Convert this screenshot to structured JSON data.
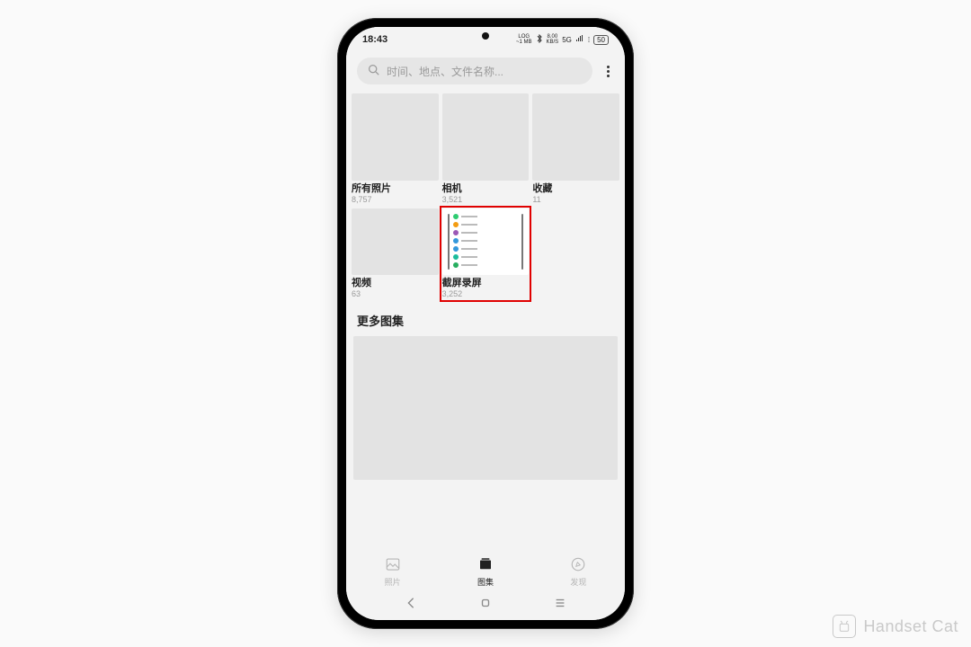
{
  "status": {
    "time": "18:43",
    "net_top": "LOG",
    "net_bot": "~1 MB",
    "speed_top": "8.00",
    "speed_bot": "KB/S",
    "signal": "5G",
    "battery": "50"
  },
  "search": {
    "placeholder": "时间、地点、文件名称..."
  },
  "albums": [
    {
      "title": "所有照片",
      "count": "8,757"
    },
    {
      "title": "相机",
      "count": "3,521"
    },
    {
      "title": "收藏",
      "count": "11"
    },
    {
      "title": "视频",
      "count": "63"
    },
    {
      "title": "截屏录屏",
      "count": "3,252"
    }
  ],
  "more_section": "更多图集",
  "tabs": {
    "photos": "照片",
    "albums": "图集",
    "discover": "发现"
  },
  "watermark": "Handset Cat"
}
